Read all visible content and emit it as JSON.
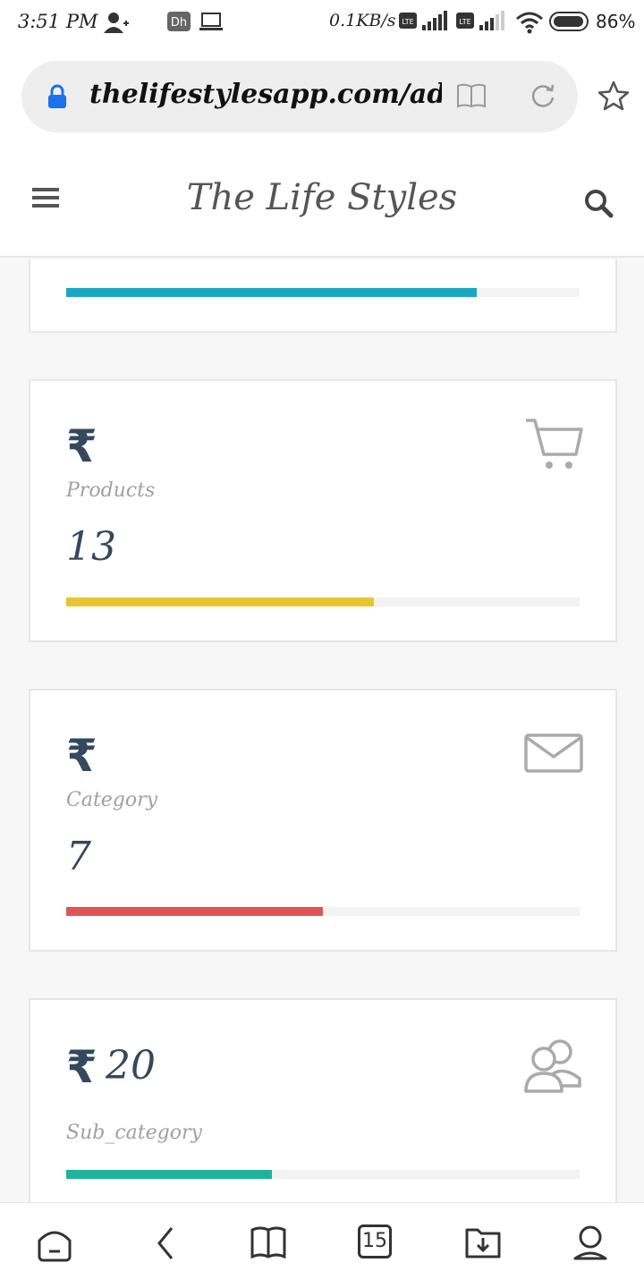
{
  "status_bar": {
    "time": "3:51 PM",
    "network_speed": "0.1KB/s",
    "battery_percent": "86%",
    "volte_label": "Vo LTE"
  },
  "browser": {
    "url": "thelifestylesapp.com/adm"
  },
  "app": {
    "title": "The Life Styles"
  },
  "cards": [
    {
      "name": "partial-top",
      "progress": 0.8,
      "color": "#1aa7c2"
    },
    {
      "name": "products",
      "currency": "₹",
      "label": "Products",
      "value": "13",
      "progress": 0.6,
      "color": "#e8c630",
      "icon": "cart-icon"
    },
    {
      "name": "category",
      "currency": "₹",
      "label": "Category",
      "value": "7",
      "progress": 0.5,
      "color": "#e25454",
      "icon": "mail-icon"
    },
    {
      "name": "sub-category",
      "currency": "₹",
      "label": "Sub_category",
      "value": "20",
      "progress": 0.4,
      "color": "#1fb39a",
      "icon": "users-icon"
    }
  ],
  "bottom_nav": {
    "tabs_count": "15",
    "items": [
      "home-icon",
      "back-icon",
      "bookmarks-icon",
      "tabs-icon",
      "downloads-icon",
      "profile-icon"
    ]
  }
}
